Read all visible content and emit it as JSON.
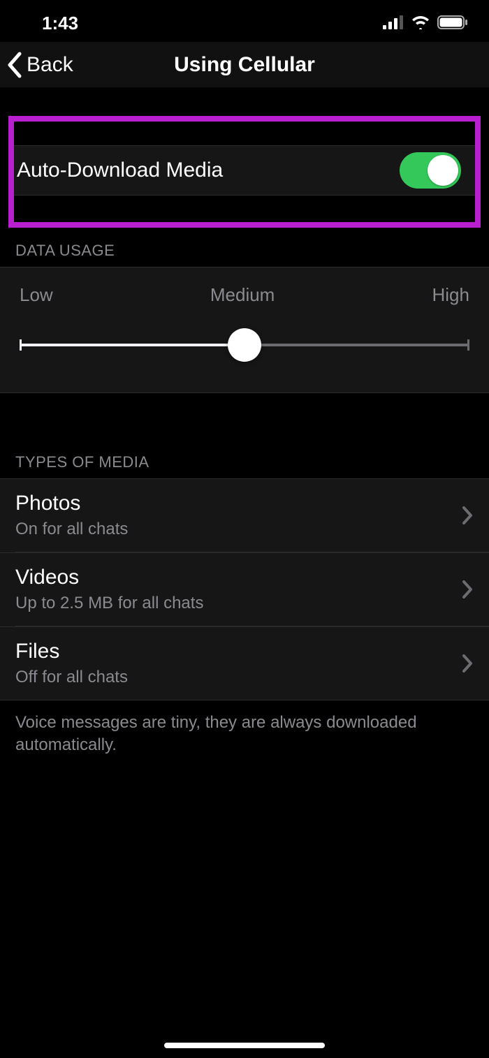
{
  "status": {
    "time": "1:43"
  },
  "nav": {
    "back_label": "Back",
    "title": "Using Cellular"
  },
  "autodl": {
    "label": "Auto-Download Media",
    "enabled": true
  },
  "data_usage": {
    "header": "DATA USAGE",
    "low": "Low",
    "medium": "Medium",
    "high": "High",
    "value_percent": 50
  },
  "types": {
    "header": "TYPES OF MEDIA",
    "rows": [
      {
        "title": "Photos",
        "sub": "On for all chats"
      },
      {
        "title": "Videos",
        "sub": "Up to 2.5 MB for all chats"
      },
      {
        "title": "Files",
        "sub": "Off for all chats"
      }
    ],
    "footer": "Voice messages are tiny, they are always downloaded automatically."
  }
}
